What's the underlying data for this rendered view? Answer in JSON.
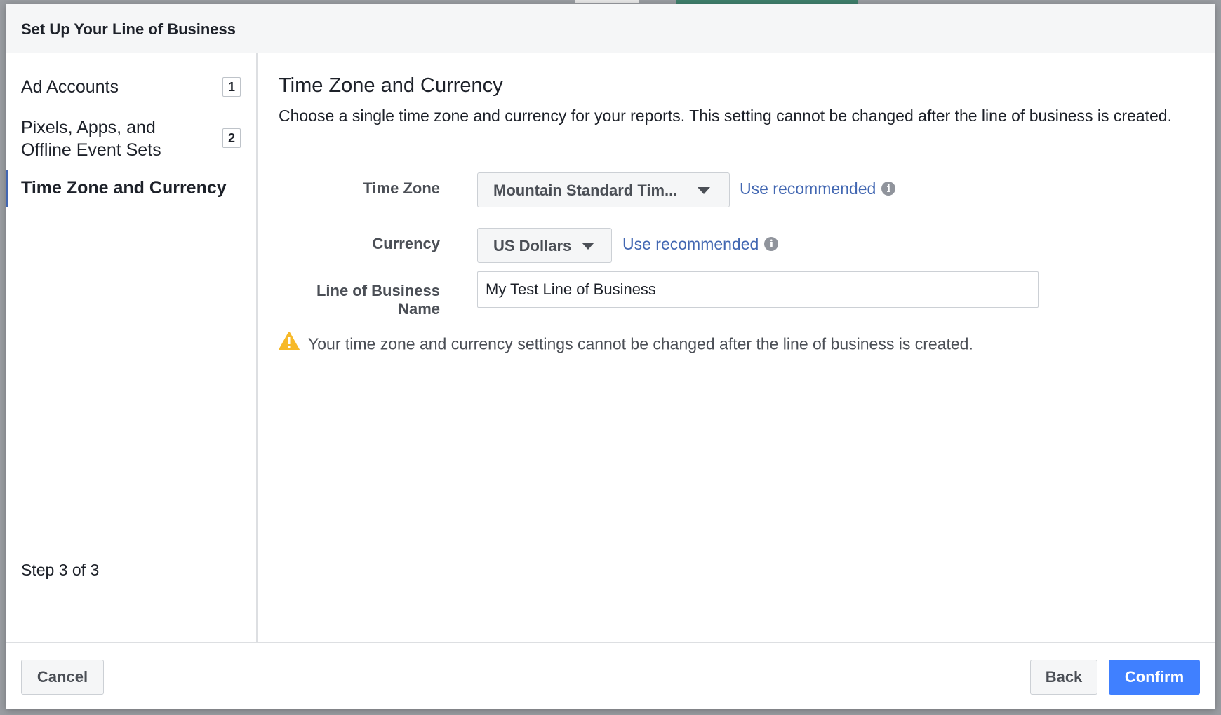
{
  "modal": {
    "title": "Set Up Your Line of Business"
  },
  "sidebar": {
    "items": [
      {
        "label": "Ad Accounts",
        "badge": "1"
      },
      {
        "label": "Pixels, Apps, and Offline Event Sets",
        "badge": "2"
      },
      {
        "label": "Time Zone and Currency",
        "active": true
      }
    ],
    "step_counter": "Step 3 of 3"
  },
  "content": {
    "title": "Time Zone and Currency",
    "description": "Choose a single time zone and currency for your reports. This setting cannot be changed after the line of business is created.",
    "time_zone": {
      "label": "Time Zone",
      "value": "Mountain Standard Tim...",
      "recommend_link": "Use recommended"
    },
    "currency": {
      "label": "Currency",
      "value": "US Dollars",
      "recommend_link": "Use recommended"
    },
    "business_name": {
      "label": "Line of Business Name",
      "value": "My Test Line of Business"
    },
    "warning": "Your time zone and currency settings cannot be changed after the line of business is created."
  },
  "footer": {
    "cancel_label": "Cancel",
    "back_label": "Back",
    "confirm_label": "Confirm"
  },
  "colors": {
    "accent_link": "#4267b2",
    "primary_button": "#4080ff",
    "warning_icon": "#f7b928",
    "active_indicator": "#4267b2"
  },
  "icons": {
    "info": "info-icon",
    "warning": "warning-icon",
    "caret": "caret-down-icon"
  }
}
